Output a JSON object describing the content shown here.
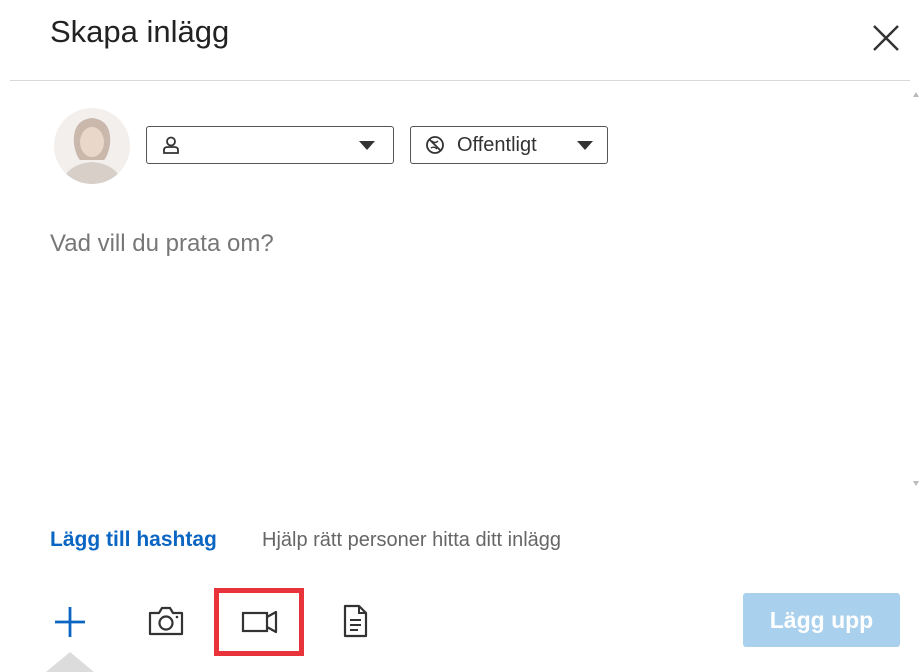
{
  "dialog": {
    "title": "Skapa inlägg",
    "close_icon": "close-icon"
  },
  "author": {
    "avatar_icon": "profile-photo",
    "selector_icon": "person-icon",
    "selector_value": ""
  },
  "visibility": {
    "icon": "globe-off-icon",
    "label": "Offentligt"
  },
  "compose": {
    "placeholder": "Vad vill du prata om?"
  },
  "hashtag": {
    "link": "Lägg till hashtag",
    "help": "Hjälp rätt personer hitta ditt inlägg"
  },
  "toolbar": {
    "icons": [
      "plus-icon",
      "camera-icon",
      "video-icon",
      "document-icon"
    ],
    "post_label": "Lägg upp"
  },
  "colors": {
    "link": "#0a66c2",
    "highlight": "#e8333a",
    "post_button_disabled": "#a9d0ec"
  }
}
